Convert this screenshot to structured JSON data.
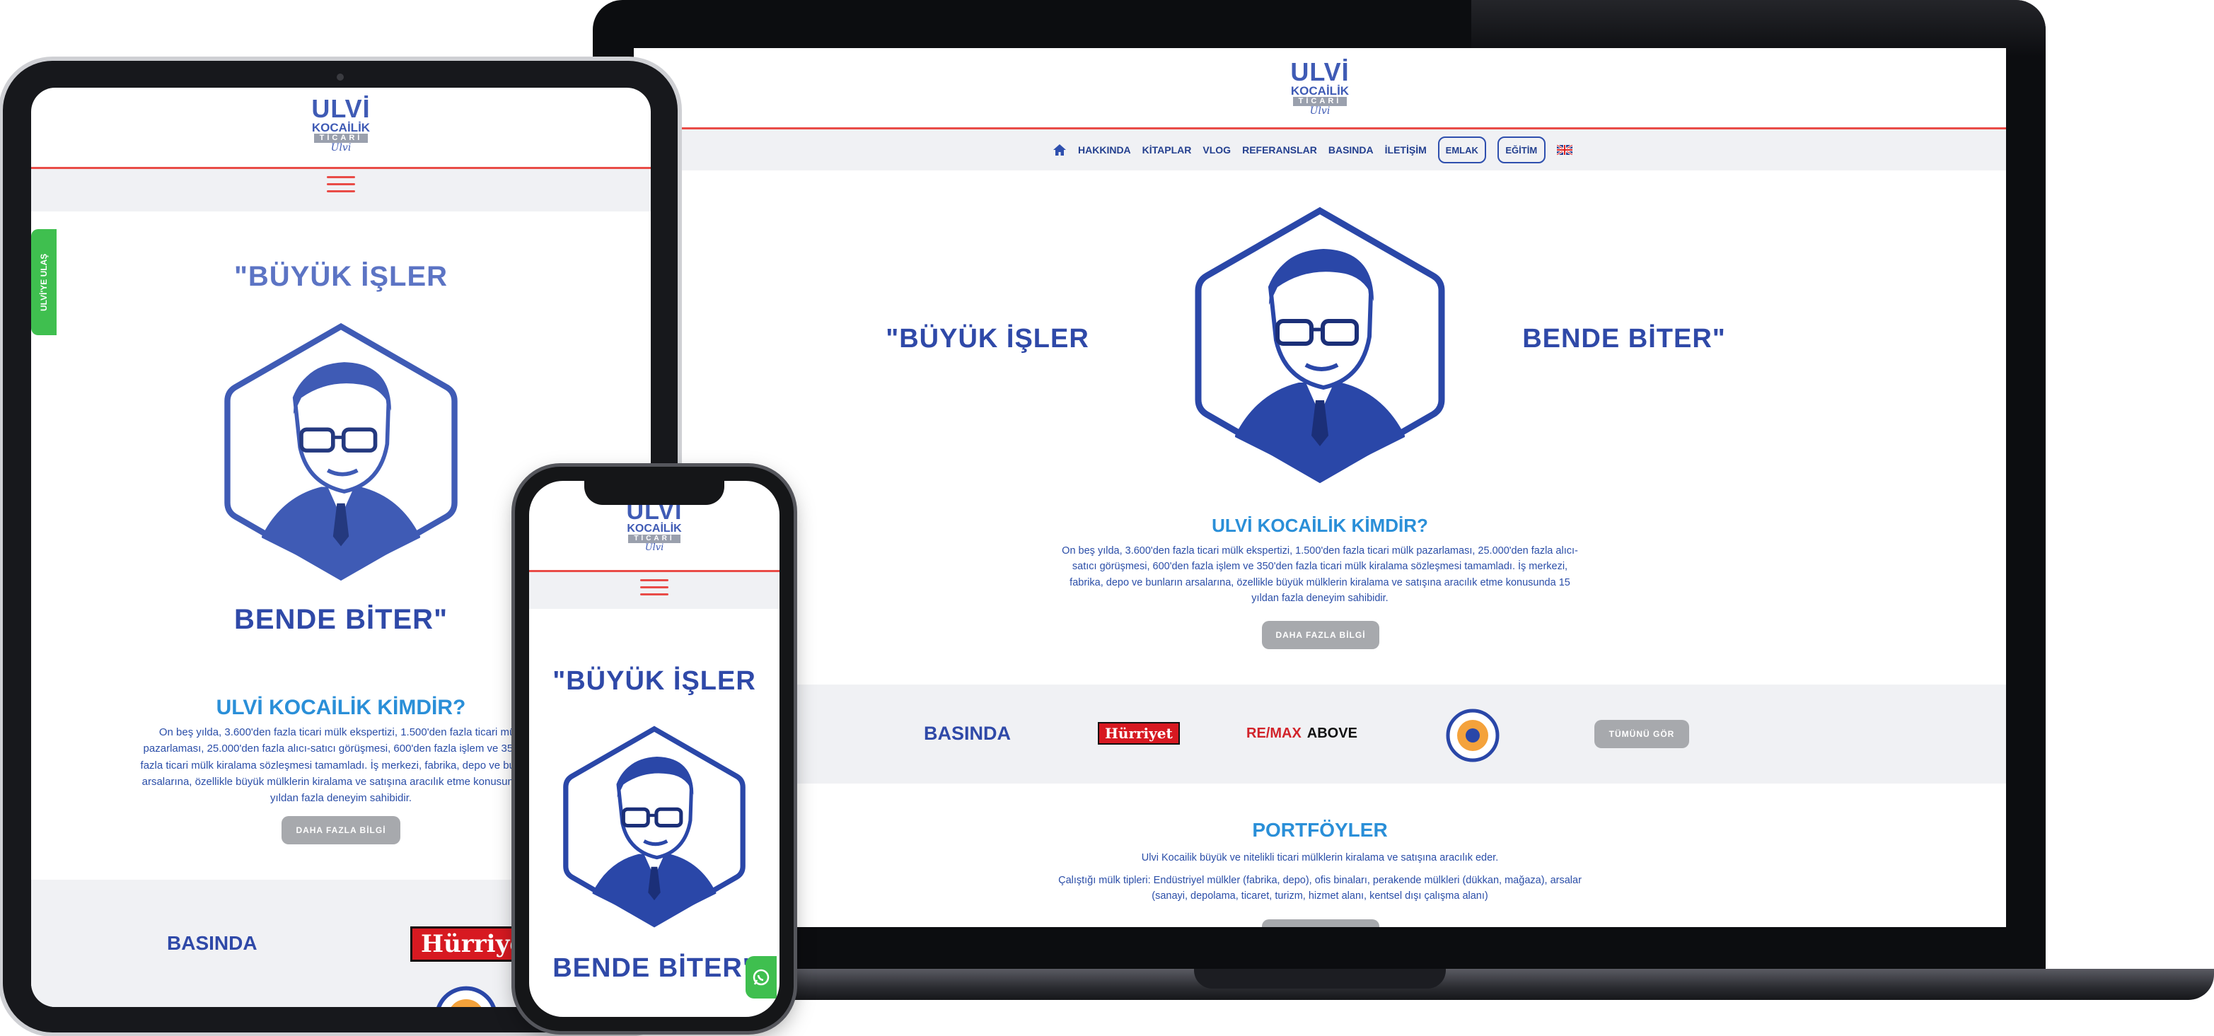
{
  "brand": {
    "line1": "ULVİ",
    "line2": "KOCAİLİK",
    "line3": "TİCARİ",
    "signature": "Ulvi"
  },
  "nav": {
    "items": [
      "HAKKINDA",
      "KİTAPLAR",
      "VLOG",
      "REFERANSLAR",
      "BASINDA",
      "İLETİŞİM"
    ],
    "pills": [
      "EMLAK",
      "EĞİTİM"
    ]
  },
  "hero": {
    "quote_left": "\"BÜYÜK İŞLER",
    "quote_right": "BENDE BİTER\""
  },
  "about": {
    "title": "ULVİ KOCAİLİK KİMDİR?",
    "text": "On beş yılda, 3.600'den fazla ticari mülk ekspertizi, 1.500'den fazla ticari mülk pazarlaması, 25.000'den fazla alıcı-satıcı görüşmesi, 600'den fazla işlem ve 350'den fazla ticari mülk kiralama sözleşmesi tamamladı. İş merkezi, fabrika, depo ve bunların arsalarına, özellikle büyük mülklerin kiralama ve satışına aracılık etme konusunda 15 yıldan fazla deneyim sahibidir.",
    "button": "DAHA FAZLA BİLGİ"
  },
  "press": {
    "title": "BASINDA",
    "logos": [
      "Hürriyet",
      "RE/MAX",
      "ABOVE"
    ],
    "button": "TÜMÜNÜ GÖR"
  },
  "portfolio": {
    "title": "PORTFÖYLER",
    "line1": "Ulvi Kocailik büyük ve nitelikli ticari mülklerin kiralama ve satışına aracılık eder.",
    "line2": "Çalıştığı mülk tipleri: Endüstriyel mülkler (fabrika, depo), ofis binaları, perakende mülkleri (dükkan, mağaza), arsalar (sanayi, depolama, ticaret, turizm, hizmet alanı, kentsel dışı çalışma alanı)"
  },
  "side_tab": "ULVİ'YE ULAŞ",
  "colors": {
    "brand_blue": "#2f49a8",
    "accent_red": "#e94c47",
    "sky": "#2a8fd8",
    "whatsapp_green": "#3fbf4f"
  }
}
